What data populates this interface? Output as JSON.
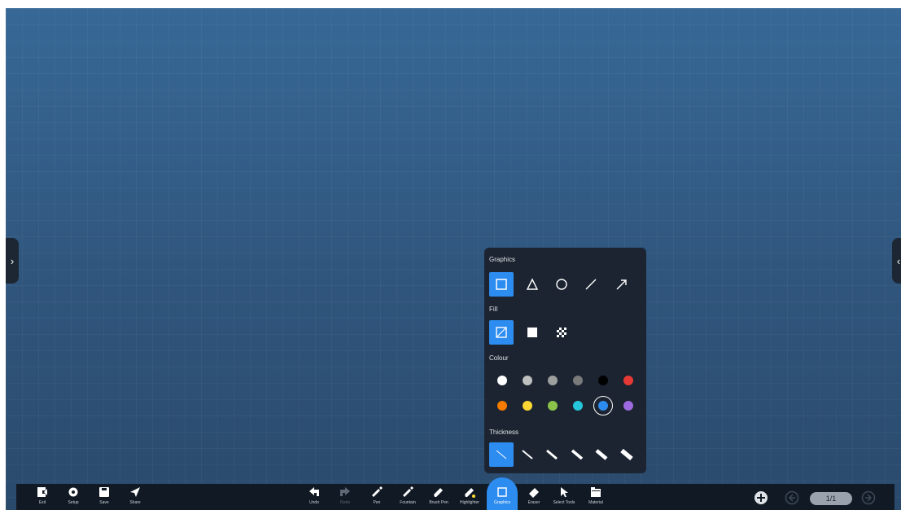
{
  "panel": {
    "graphics_title": "Graphics",
    "fill_title": "Fill",
    "colour_title": "Colour",
    "thickness_title": "Thickness",
    "shapes": [
      "rectangle",
      "triangle",
      "circle",
      "line",
      "arrow"
    ],
    "selected_shape": "rectangle",
    "fills": [
      "no-fill",
      "solid-fill",
      "pattern-fill"
    ],
    "selected_fill": "no-fill",
    "colours_row1": [
      "#ffffff",
      "#bfbfbf",
      "#9e9e9e",
      "#7a7a7a",
      "#000000",
      "#e53935"
    ],
    "colours_row2": [
      "#f57c00",
      "#fdd835",
      "#8bc34a",
      "#26c6da",
      "#2d8cf0",
      "#9c6ade"
    ],
    "selected_colour": "#2d8cf0",
    "thickness_levels": 6,
    "selected_thickness": 1
  },
  "toolbar": {
    "exit": "Exit",
    "setup": "Setup",
    "save": "Save",
    "share": "Share",
    "undo": "Undo",
    "redo": "Redo",
    "pen": "Pen",
    "fountain": "Fountain",
    "brush_pen": "Brush Pen",
    "highlighter": "Highlighter",
    "graphics": "Graphics",
    "eraser": "Eraser",
    "select_tools": "Select Tools",
    "material": "Material",
    "page": "1/1"
  },
  "colors": {
    "accent": "#2d8cf0",
    "toolbar_bg": "#111a24",
    "panel_bg": "#1b2430",
    "board": "#345f88"
  }
}
